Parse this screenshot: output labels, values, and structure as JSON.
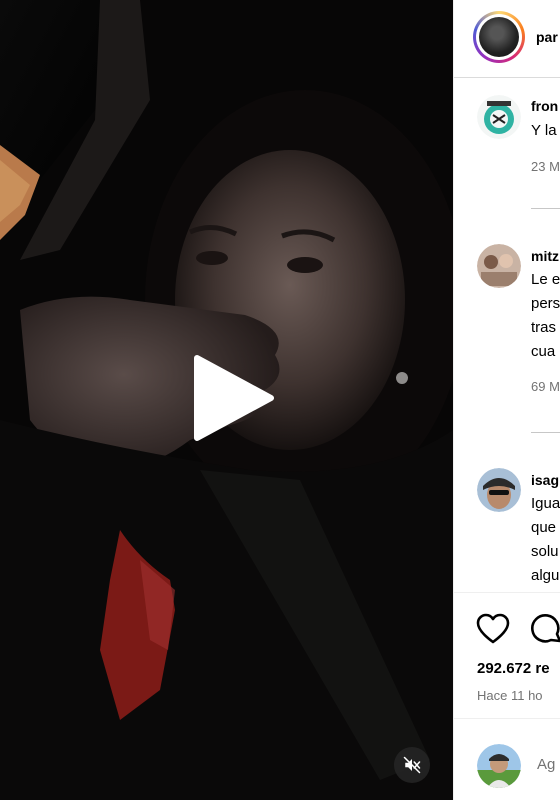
{
  "post": {
    "username": "par",
    "likes_text": "292.672 re",
    "time_text": "Hace 11 ho"
  },
  "comments": [
    {
      "username": "fron",
      "lines": "Y la",
      "meta": "23 M"
    },
    {
      "username": "mitz",
      "lines": "Le e\npers\ntras\ncua",
      "meta": "69 M"
    },
    {
      "username": "isag",
      "lines": "Igua\nque\nsolu\nalgu",
      "meta": ""
    }
  ],
  "add_comment": {
    "placeholder": "Ag"
  },
  "icons": {
    "play": "play-icon",
    "mute": "speaker-muted-icon",
    "like": "heart-icon",
    "comment": "comment-bubble-icon"
  },
  "colors": {
    "text_secondary": "#737373",
    "divider": "#dbdbdb",
    "video_bg": "#050505"
  }
}
